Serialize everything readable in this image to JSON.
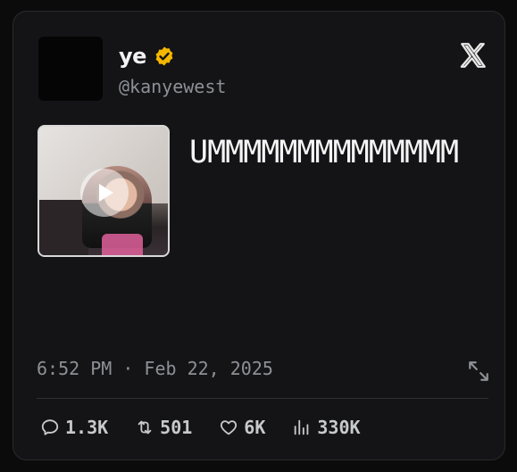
{
  "author": {
    "name": "ye",
    "handle": "@kanyewest",
    "verified_color": "#f5b700"
  },
  "tweet": {
    "text": "UMMMMMMMMMMMMMM"
  },
  "meta": {
    "timestamp": "6:52 PM · Feb 22, 2025"
  },
  "stats": {
    "replies": "1.3K",
    "reposts": "501",
    "likes": "6K",
    "views": "330K"
  },
  "icons": {
    "brand": "x-logo-icon",
    "play": "play-icon",
    "expand": "expand-icon",
    "reply": "reply-icon",
    "repost": "repost-icon",
    "like": "heart-icon",
    "views": "views-icon"
  }
}
